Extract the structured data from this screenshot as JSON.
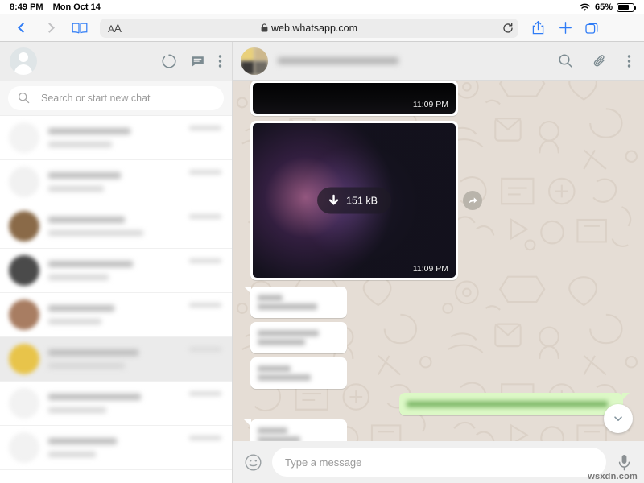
{
  "status_bar": {
    "time": "8:49 PM",
    "date": "Mon Oct 14",
    "wifi_icon": "wifi-icon",
    "battery_percent": "65%",
    "battery_icon": "battery-icon"
  },
  "browser": {
    "back_icon": "chevron-left-icon",
    "forward_icon": "chevron-right-icon",
    "bookmarks_icon": "book-icon",
    "text_size_label": "AA",
    "lock_icon": "lock-icon",
    "url": "web.whatsapp.com",
    "reload_icon": "reload-icon",
    "share_icon": "share-icon",
    "new_tab_icon": "plus-icon",
    "tabs_icon": "tabs-icon",
    "accent_color": "#2f7cf6"
  },
  "sidebar": {
    "profile_avatar": "avatar",
    "status_icon": "status-circle-icon",
    "new_chat_icon": "new-chat-icon",
    "menu_icon": "kebab-menu-icon",
    "search": {
      "icon": "search-icon",
      "placeholder": "Search or start new chat"
    },
    "chats": [
      {
        "avatar_color": "#f3f3f3",
        "selected": false,
        "line1_width": "62%",
        "line2_width": "48%"
      },
      {
        "avatar_color": "#f1f1f1",
        "selected": false,
        "line1_width": "55%",
        "line2_width": "42%"
      },
      {
        "avatar_color": "#8a6a48",
        "selected": false,
        "line1_width": "58%",
        "line2_width": "72%"
      },
      {
        "avatar_color": "#4a4a4a",
        "selected": false,
        "line1_width": "64%",
        "line2_width": "46%"
      },
      {
        "avatar_color": "#a87d62",
        "selected": false,
        "line1_width": "50%",
        "line2_width": "40%"
      },
      {
        "avatar_color": "#e8c44a",
        "selected": true,
        "line1_width": "68%",
        "line2_width": "58%"
      },
      {
        "avatar_color": "#f2f2f2",
        "selected": false,
        "line1_width": "70%",
        "line2_width": "44%"
      },
      {
        "avatar_color": "#f2f2f2",
        "selected": false,
        "line1_width": "52%",
        "line2_width": "36%"
      }
    ]
  },
  "chat": {
    "contact_avatar": "contact-avatar",
    "contact_name_blurred": true,
    "search_icon": "search-icon",
    "attach_icon": "paperclip-icon",
    "menu_icon": "kebab-menu-icon",
    "wallpaper_color": "#e5ddd5",
    "messages": [
      {
        "type": "media",
        "direction": "in",
        "timestamp": "11:09 PM",
        "partial": true
      },
      {
        "type": "media",
        "direction": "in",
        "timestamp": "11:09 PM",
        "download_label": "151 kB",
        "download_icon": "download-arrow-icon",
        "forward_icon": "forward-arrow-icon"
      },
      {
        "type": "text",
        "direction": "in",
        "lines": [
          "30%",
          "72%"
        ]
      },
      {
        "type": "text",
        "direction": "in",
        "lines": [
          "74%",
          "58%"
        ]
      },
      {
        "type": "text",
        "direction": "in",
        "lines": [
          "40%",
          "64%"
        ]
      },
      {
        "type": "text",
        "direction": "out",
        "lines": [
          "96%"
        ]
      },
      {
        "type": "text",
        "direction": "in",
        "lines": [
          "36%",
          "52%"
        ]
      },
      {
        "type": "text",
        "direction": "in",
        "lines": [
          "46%",
          "60%"
        ]
      }
    ],
    "scroll_down_icon": "chevron-down-icon",
    "outgoing_bubble_color": "#dcf8c6",
    "incoming_bubble_color": "#ffffff"
  },
  "composer": {
    "emoji_icon": "emoji-smiley-icon",
    "placeholder": "Type a message",
    "mic_icon": "microphone-icon"
  },
  "watermark": {
    "text": "wsxdn.com"
  }
}
